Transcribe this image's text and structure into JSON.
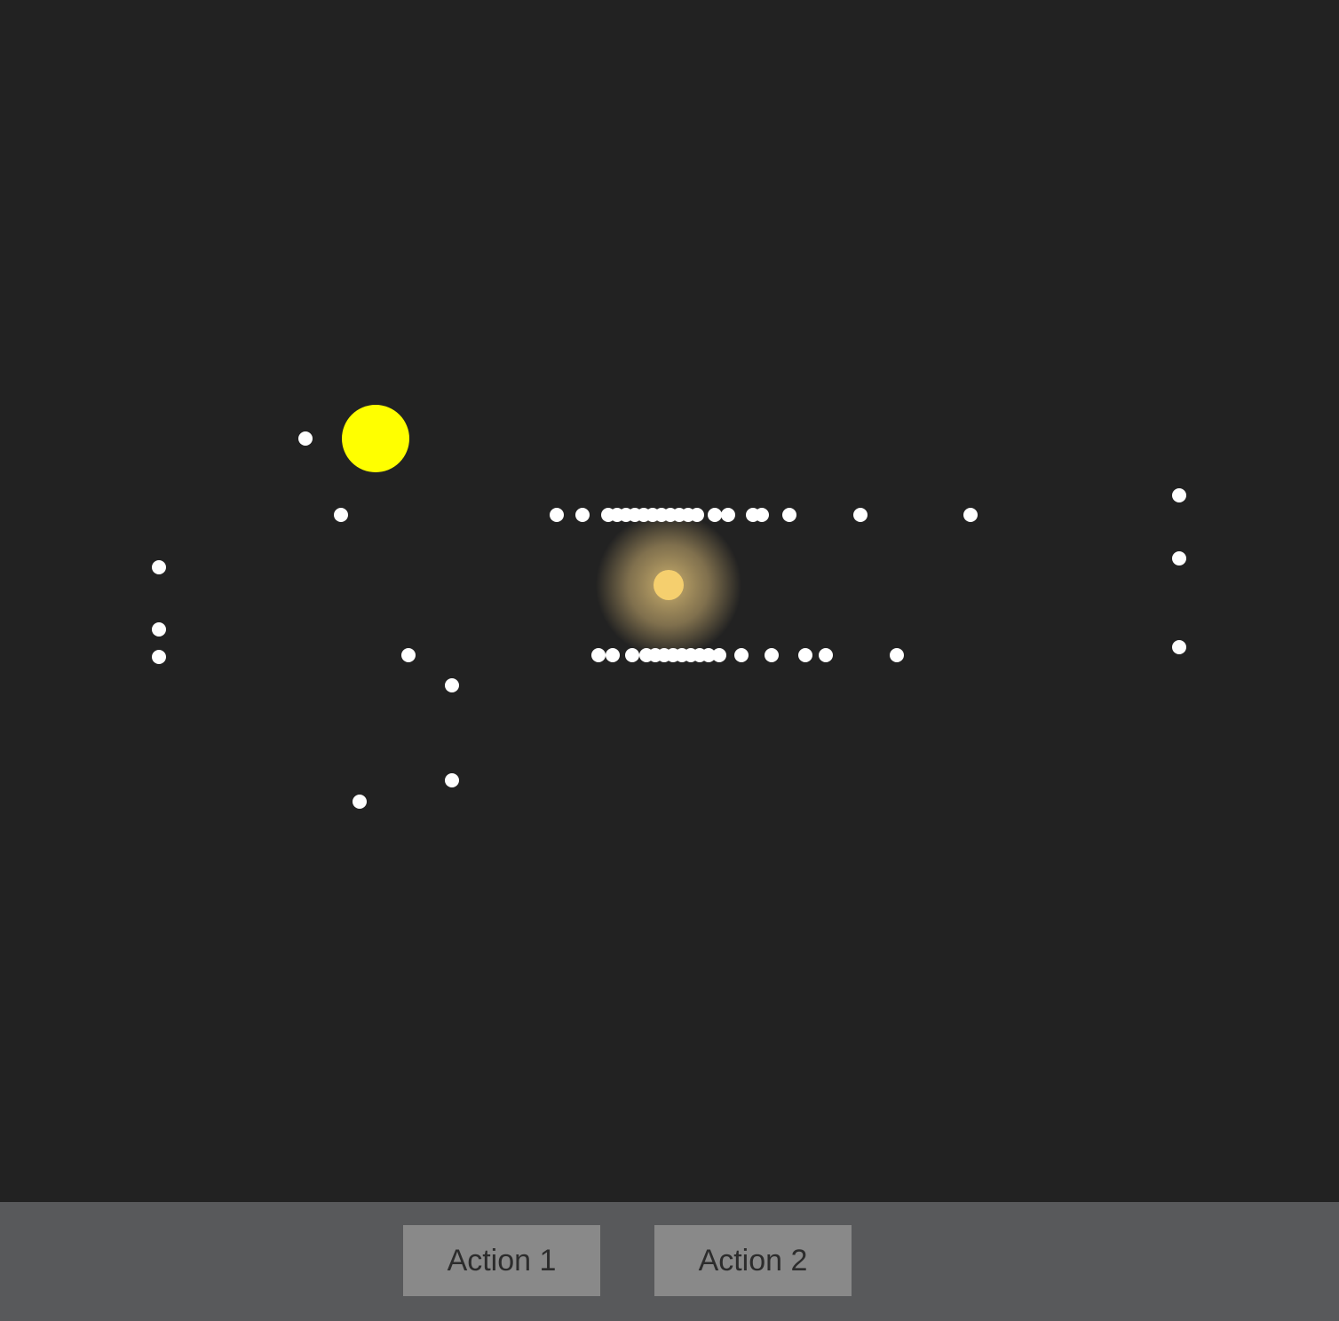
{
  "colors": {
    "background": "#222222",
    "toolbar": "#58595b",
    "button": "#898989",
    "button_text": "#2c2c2c",
    "dot": "#ffffff",
    "player": "#ffff00",
    "light_core": "#f5cf6e",
    "light_glow": "#e8c87a"
  },
  "toolbar": {
    "buttons": [
      {
        "label": "Action 1"
      },
      {
        "label": "Action 2"
      }
    ]
  },
  "icons": [
    "player-icon",
    "light-source-icon",
    "pellet-icon"
  ]
}
